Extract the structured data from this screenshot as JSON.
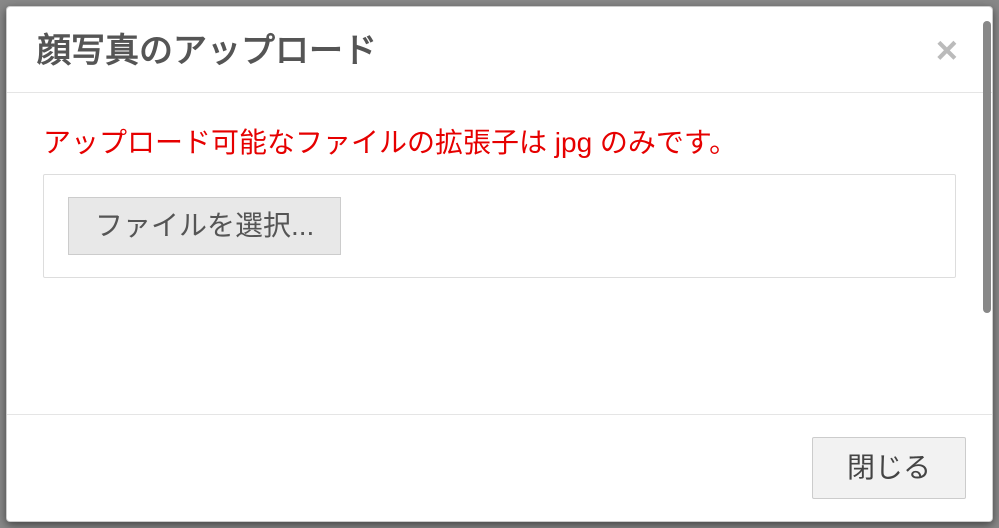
{
  "modal": {
    "title": "顔写真のアップロード",
    "close_icon": "×",
    "error_message": "アップロード可能なファイルの拡張子は jpg のみです。",
    "file_select_label": "ファイルを選択...",
    "footer_close_label": "閉じる"
  }
}
